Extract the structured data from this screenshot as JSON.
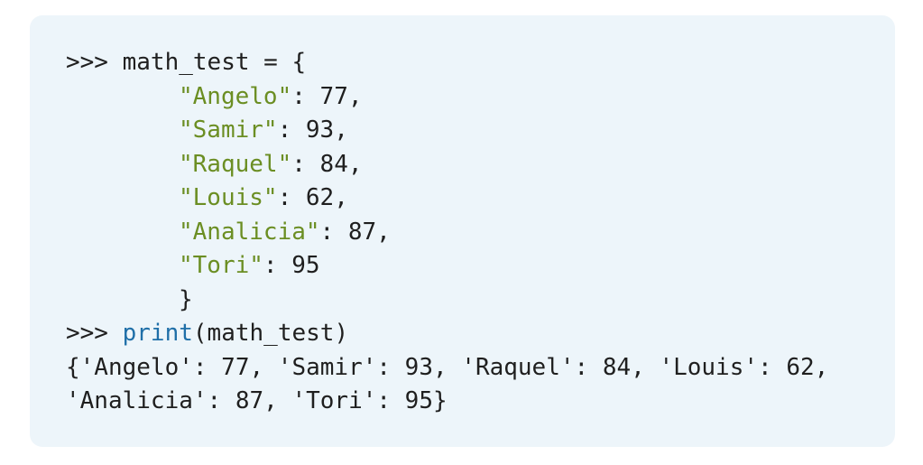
{
  "code": {
    "prompt": ">>>",
    "assign_line": "math_test = {",
    "entries": [
      {
        "key": "\"Angelo\"",
        "value": ": 77,"
      },
      {
        "key": "\"Samir\"",
        "value": ": 93,"
      },
      {
        "key": "\"Raquel\"",
        "value": ": 84,"
      },
      {
        "key": "\"Louis\"",
        "value": ": 62,"
      },
      {
        "key": "\"Analicia\"",
        "value": ": 87,"
      },
      {
        "key": "\"Tori\"",
        "value": ": 95"
      }
    ],
    "close_brace": "}",
    "print_fn": "print",
    "print_args": "(math_test)",
    "output_line_1": "{'Angelo': 77, 'Samir': 93, 'Raquel': 84, 'Louis': 62,",
    "output_line_2": "'Analicia': 87, 'Tori': 95}"
  },
  "colors": {
    "background": "#edf5fa",
    "string": "#6b8e23",
    "builtin": "#1f6fa8",
    "text": "#1f1f1f"
  }
}
